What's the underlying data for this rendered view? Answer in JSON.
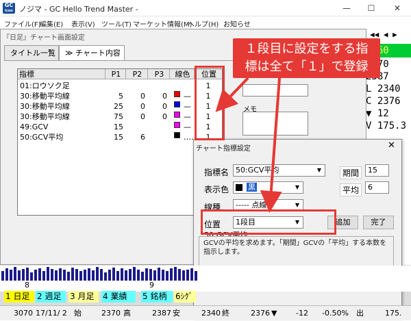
{
  "app": {
    "icon_text_top": "GC",
    "icon_text_bottom": "icon",
    "title": "ノジマ - GC Hello Trend Master -",
    "minimize": "—",
    "maximize": "☐",
    "close": "✕"
  },
  "menu": [
    "ファイル(F)",
    "編集(E)",
    "表示(V)",
    "ツール(T)",
    "マーケット情報(M)",
    "ヘルプ(H)",
    "お知らせ"
  ],
  "right_values": {
    "nav": "◀◀ ◀ ▶",
    "v1": "2.60",
    "v2": "2370",
    "v3": "2387",
    "v4": "L  2340",
    "v5": "C  2376",
    "v6": "▼   12",
    "v7": "V 175.3"
  },
  "chart_dialog": {
    "title": "『日足』チャート画面設定",
    "tabs": [
      "タイトル一覧",
      "≫ チャート内容"
    ],
    "columns": [
      "指標",
      "P1",
      "P2",
      "P3",
      "線色",
      "位置"
    ],
    "rows": [
      {
        "name": "01:ロウソク足",
        "p1": "",
        "p2": "",
        "p3": "",
        "color": "",
        "line": "",
        "pos": "1"
      },
      {
        "name": "30:移動平均線",
        "p1": "5",
        "p2": "0",
        "p3": "0",
        "color": "#ee0000",
        "line": "—",
        "pos": "1"
      },
      {
        "name": "30:移動平均線",
        "p1": "25",
        "p2": "0",
        "p3": "0",
        "color": "#0000ee",
        "line": "—",
        "pos": "1"
      },
      {
        "name": "30:移動平均線",
        "p1": "75",
        "p2": "0",
        "p3": "0",
        "color": "#ee00ee",
        "line": "—",
        "pos": "1"
      },
      {
        "name": "49:GCV",
        "p1": "15",
        "p2": "",
        "p3": "",
        "color": "#ff00ff",
        "line": "—",
        "pos": "1"
      },
      {
        "name": "50:GCV平均",
        "p1": "15",
        "p2": "6",
        "p3": "",
        "color": "#000000",
        "line": "……",
        "pos": "1"
      }
    ],
    "memo_label": "メモ"
  },
  "indicator_dialog": {
    "title": "チャート指標設定",
    "close": "✕",
    "name_label": "指標名",
    "name_value": "50:GCV平均",
    "period_label": "期間",
    "period_value": "15",
    "avg_label": "平均",
    "avg_value": "6",
    "color_label": "表示色",
    "color_value": "黒",
    "color_hex": "#000000",
    "linetype_label": "線種",
    "linetype_value": "----- 点線",
    "position_label": "位置",
    "position_value": "1段目",
    "add_button": "追加",
    "done_button": "完了",
    "section_label": "50:GCV平均",
    "description": "GCVの平均を求めます。「期間」GCVの「平均」する本数を指示します。"
  },
  "callout": {
    "line1": "１段目に設定をする指",
    "line2": "標は全て「１」で登録"
  },
  "axis": {
    "label1": "8",
    "label2": "9"
  },
  "bottom_tabs": [
    {
      "num": "1",
      "label": "日足",
      "bg": "#ffff00"
    },
    {
      "num": "2",
      "label": "週足",
      "bg": "#66ffff"
    },
    {
      "num": "3",
      "label": "月足",
      "bg": "#ffff99"
    },
    {
      "num": "4",
      "label": "業績",
      "bg": "#66ffff"
    },
    {
      "num": "5",
      "label": "銘柄",
      "bg": "#66ffff"
    },
    {
      "num": "6",
      "label": "ｼｸﾞ",
      "bg": "#ffff99"
    }
  ],
  "status": {
    "code": "3070",
    "date": "17/11/ 2",
    "open_label": "始",
    "open": "2370",
    "high_label": "高",
    "high": "2387",
    "low_label": "安",
    "low": "2340",
    "close_label": "終",
    "close": "2376",
    "arrow": "▼",
    "change": "-12",
    "pct": "-0.50%",
    "vol_label": "出",
    "vol": "175."
  }
}
